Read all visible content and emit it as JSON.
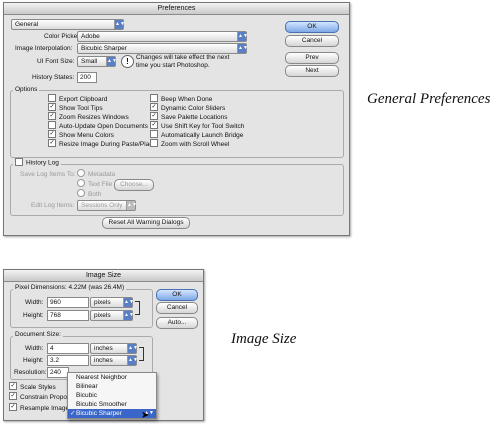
{
  "preferences": {
    "title": "Preferences",
    "section_select": "General",
    "color_picker_label": "Color Picker:",
    "color_picker_value": "Adobe",
    "interpolation_label": "Image Interpolation:",
    "interpolation_value": "Bicubic Sharper",
    "ui_font_label": "UI Font Size:",
    "ui_font_value": "Small",
    "ui_font_note_line1": "Changes will take effect the next",
    "ui_font_note_line2": "time you start Photoshop.",
    "history_states_label": "History States:",
    "history_states_value": "200",
    "options_label": "Options",
    "options_left": [
      {
        "label": "Export Clipboard",
        "checked": false
      },
      {
        "label": "Show Tool Tips",
        "checked": true
      },
      {
        "label": "Zoom Resizes Windows",
        "checked": true
      },
      {
        "label": "Auto-Update Open Documents",
        "checked": false
      },
      {
        "label": "Show Menu Colors",
        "checked": true
      },
      {
        "label": "Resize Image During Paste/Place",
        "checked": true
      }
    ],
    "options_right": [
      {
        "label": "Beep When Done",
        "checked": false
      },
      {
        "label": "Dynamic Color Sliders",
        "checked": true
      },
      {
        "label": "Save Palette Locations",
        "checked": true
      },
      {
        "label": "Use Shift Key for Tool Switch",
        "checked": true
      },
      {
        "label": "Automatically Launch Bridge",
        "checked": false
      },
      {
        "label": "Zoom with Scroll Wheel",
        "checked": false
      }
    ],
    "history_log_label": "History Log",
    "save_log_label": "Save Log Items To:",
    "radio_metadata": "Metadata",
    "radio_text_file": "Text File",
    "choose_button": "Choose...",
    "radio_both": "Both",
    "edit_log_label": "Edit Log Items:",
    "edit_log_value": "Sessions Only",
    "reset_warnings_button": "Reset All Warning Dialogs",
    "ok_button": "OK",
    "cancel_button": "Cancel",
    "prev_button": "Prev",
    "next_button": "Next"
  },
  "image_size": {
    "title": "Image Size",
    "pixel_dimensions_label": "Pixel Dimensions:",
    "pixel_dimensions_value": "4.22M (was 26.4M)",
    "width_label": "Width:",
    "width_value": "960",
    "width_unit": "pixels",
    "height_label": "Height:",
    "height_value": "768",
    "height_unit": "pixels",
    "document_size_label": "Document Size:",
    "doc_width_label": "Width:",
    "doc_width_value": "4",
    "doc_width_unit": "inches",
    "doc_height_label": "Height:",
    "doc_height_value": "3.2",
    "doc_height_unit": "inches",
    "resolution_label": "Resolution:",
    "resolution_value": "240",
    "scale_styles": "Scale Styles",
    "constrain_proportions": "Constrain Proportio",
    "resample_image": "Resample Image:",
    "ok_button": "OK",
    "cancel_button": "Cancel",
    "auto_button": "Auto...",
    "resample_menu": [
      {
        "label": "Nearest Neighbor",
        "selected": false
      },
      {
        "label": "Bilinear",
        "selected": false
      },
      {
        "label": "Bicubic",
        "selected": false
      },
      {
        "label": "Bicubic Smoother",
        "selected": false
      },
      {
        "label": "Bicubic Sharper",
        "selected": true
      }
    ]
  },
  "captions": {
    "general": "General Preferences",
    "image_size": "Image Size"
  }
}
